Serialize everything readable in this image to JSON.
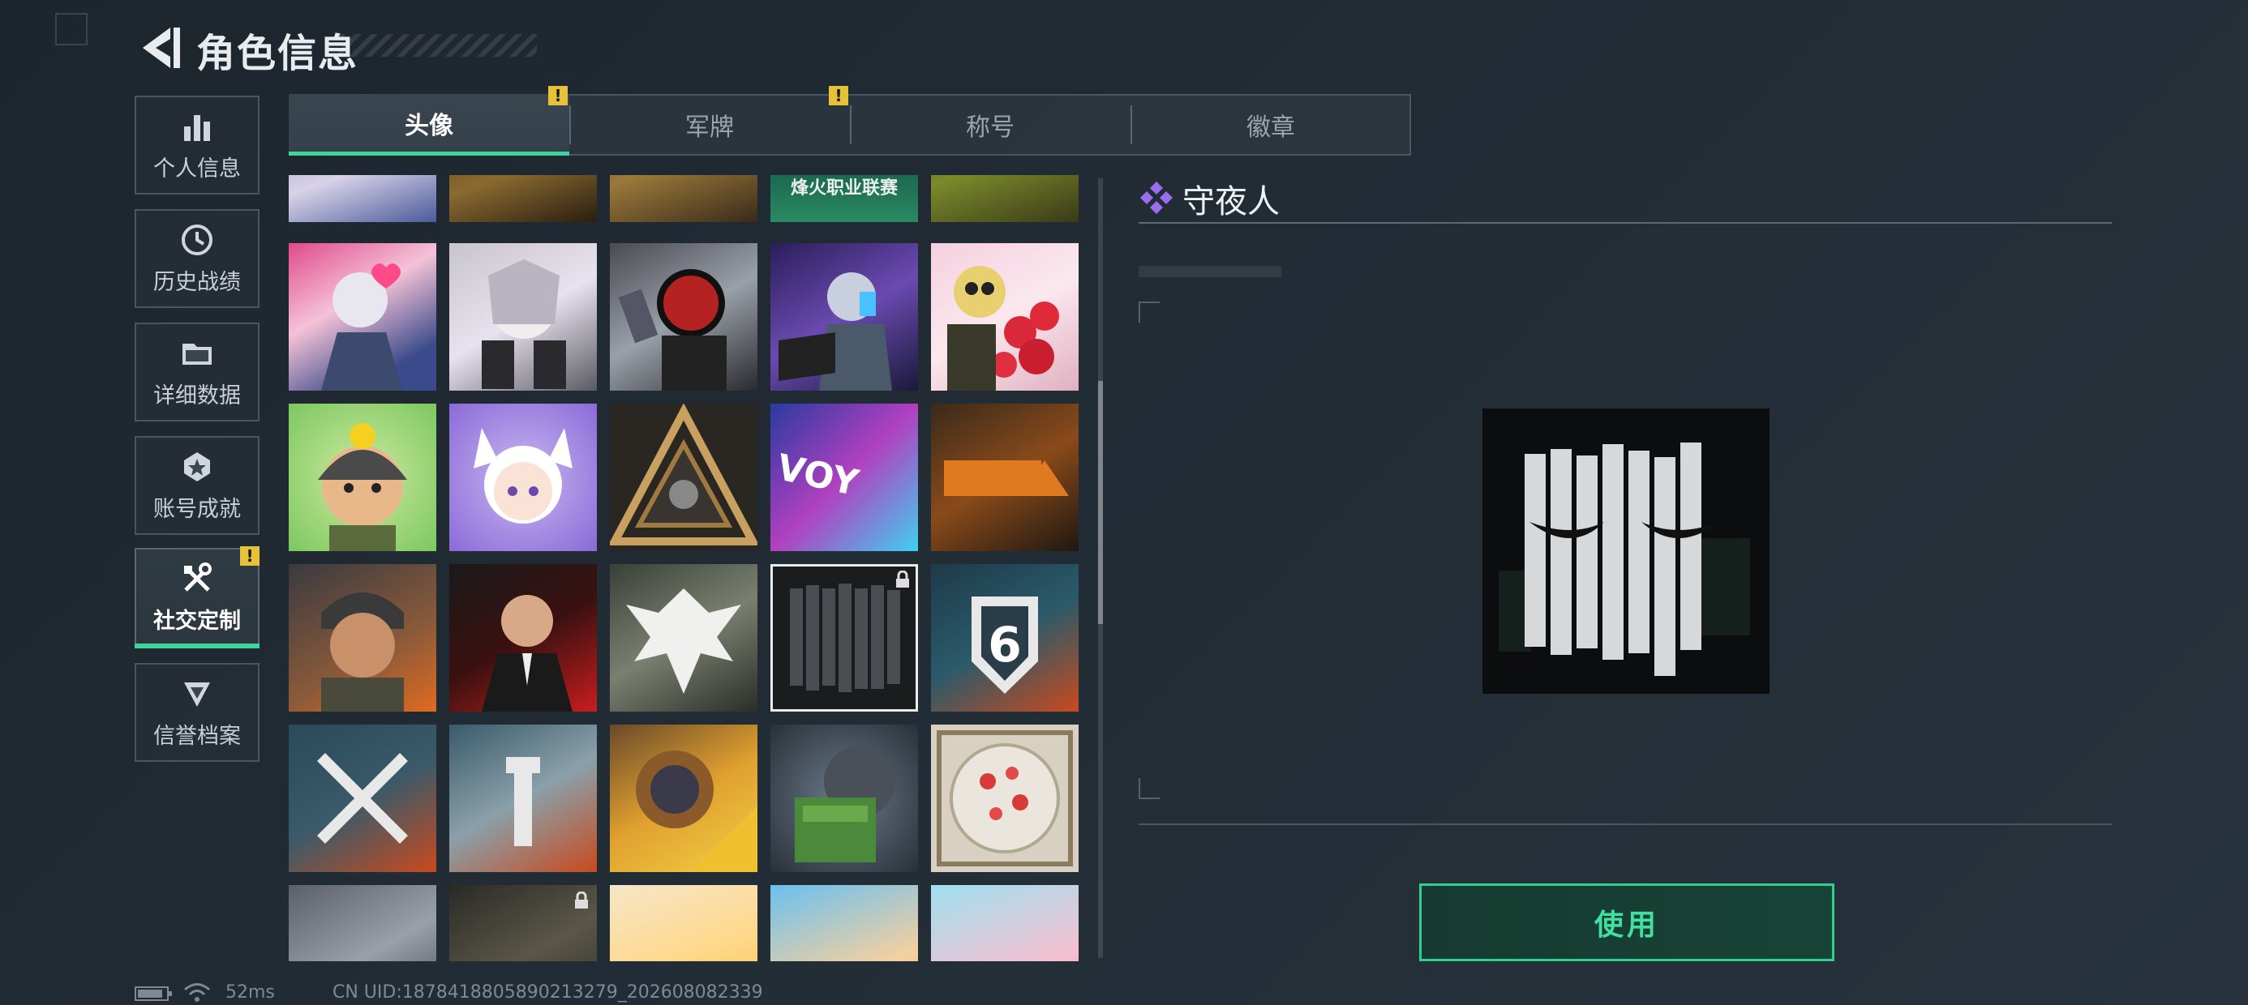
{
  "header": {
    "title": "角色信息"
  },
  "sidebar": {
    "items": [
      {
        "label": "个人信息",
        "icon": "bar-chart-icon"
      },
      {
        "label": "历史战绩",
        "icon": "history-icon"
      },
      {
        "label": "详细数据",
        "icon": "folder-icon"
      },
      {
        "label": "账号成就",
        "icon": "achievement-icon"
      },
      {
        "label": "社交定制",
        "icon": "tools-icon",
        "active": true,
        "notice": "!"
      },
      {
        "label": "信誉档案",
        "icon": "credit-icon"
      }
    ]
  },
  "tabs": [
    {
      "label": "头像",
      "active": true,
      "notice": "!"
    },
    {
      "label": "军牌",
      "notice": "!"
    },
    {
      "label": "称号"
    },
    {
      "label": "徽章"
    }
  ],
  "avatar_grid": {
    "row0_banner_text": "烽火职业联赛"
  },
  "detail": {
    "name": "守夜人",
    "use_label": "使用"
  },
  "status_bar": {
    "ping": "52ms",
    "uid": "CN UID:1878418805890213279_202608082339"
  },
  "colors": {
    "accent": "#3fd49b",
    "notice": "#e6c13a",
    "diamond": "#9a6cf0"
  }
}
